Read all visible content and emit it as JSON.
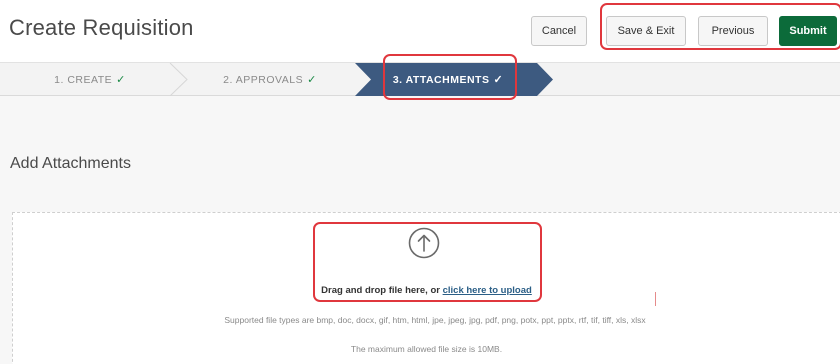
{
  "header": {
    "title": "Create Requisition",
    "buttons": {
      "cancel": "Cancel",
      "save_exit": "Save & Exit",
      "previous": "Previous",
      "submit": "Submit"
    }
  },
  "steps": [
    {
      "label": "1. CREATE",
      "check": "✓",
      "state": "complete"
    },
    {
      "label": "2. APPROVALS",
      "check": "✓",
      "state": "complete"
    },
    {
      "label": "3. ATTACHMENTS",
      "check": "✓",
      "state": "active"
    }
  ],
  "attachments": {
    "title": "Add Attachments",
    "drop_prefix": "Drag and drop file here, or ",
    "drop_link": "click here to upload",
    "supported_types": "Supported file types are bmp, doc, docx, gif, htm, html, jpe, jpeg, jpg, pdf, png, potx, ppt, pptx, rtf, tif, tiff, xls, xlsx",
    "max_size": "The maximum allowed file size is 10MB."
  },
  "colors": {
    "submit": "#0c6b3a",
    "active_step": "#3d5a80",
    "highlight": "#e0373d",
    "check": "#1b8a46",
    "link": "#2a5e86"
  },
  "icons": {
    "upload": "arrow-up-circle-icon",
    "check": "check-icon"
  }
}
